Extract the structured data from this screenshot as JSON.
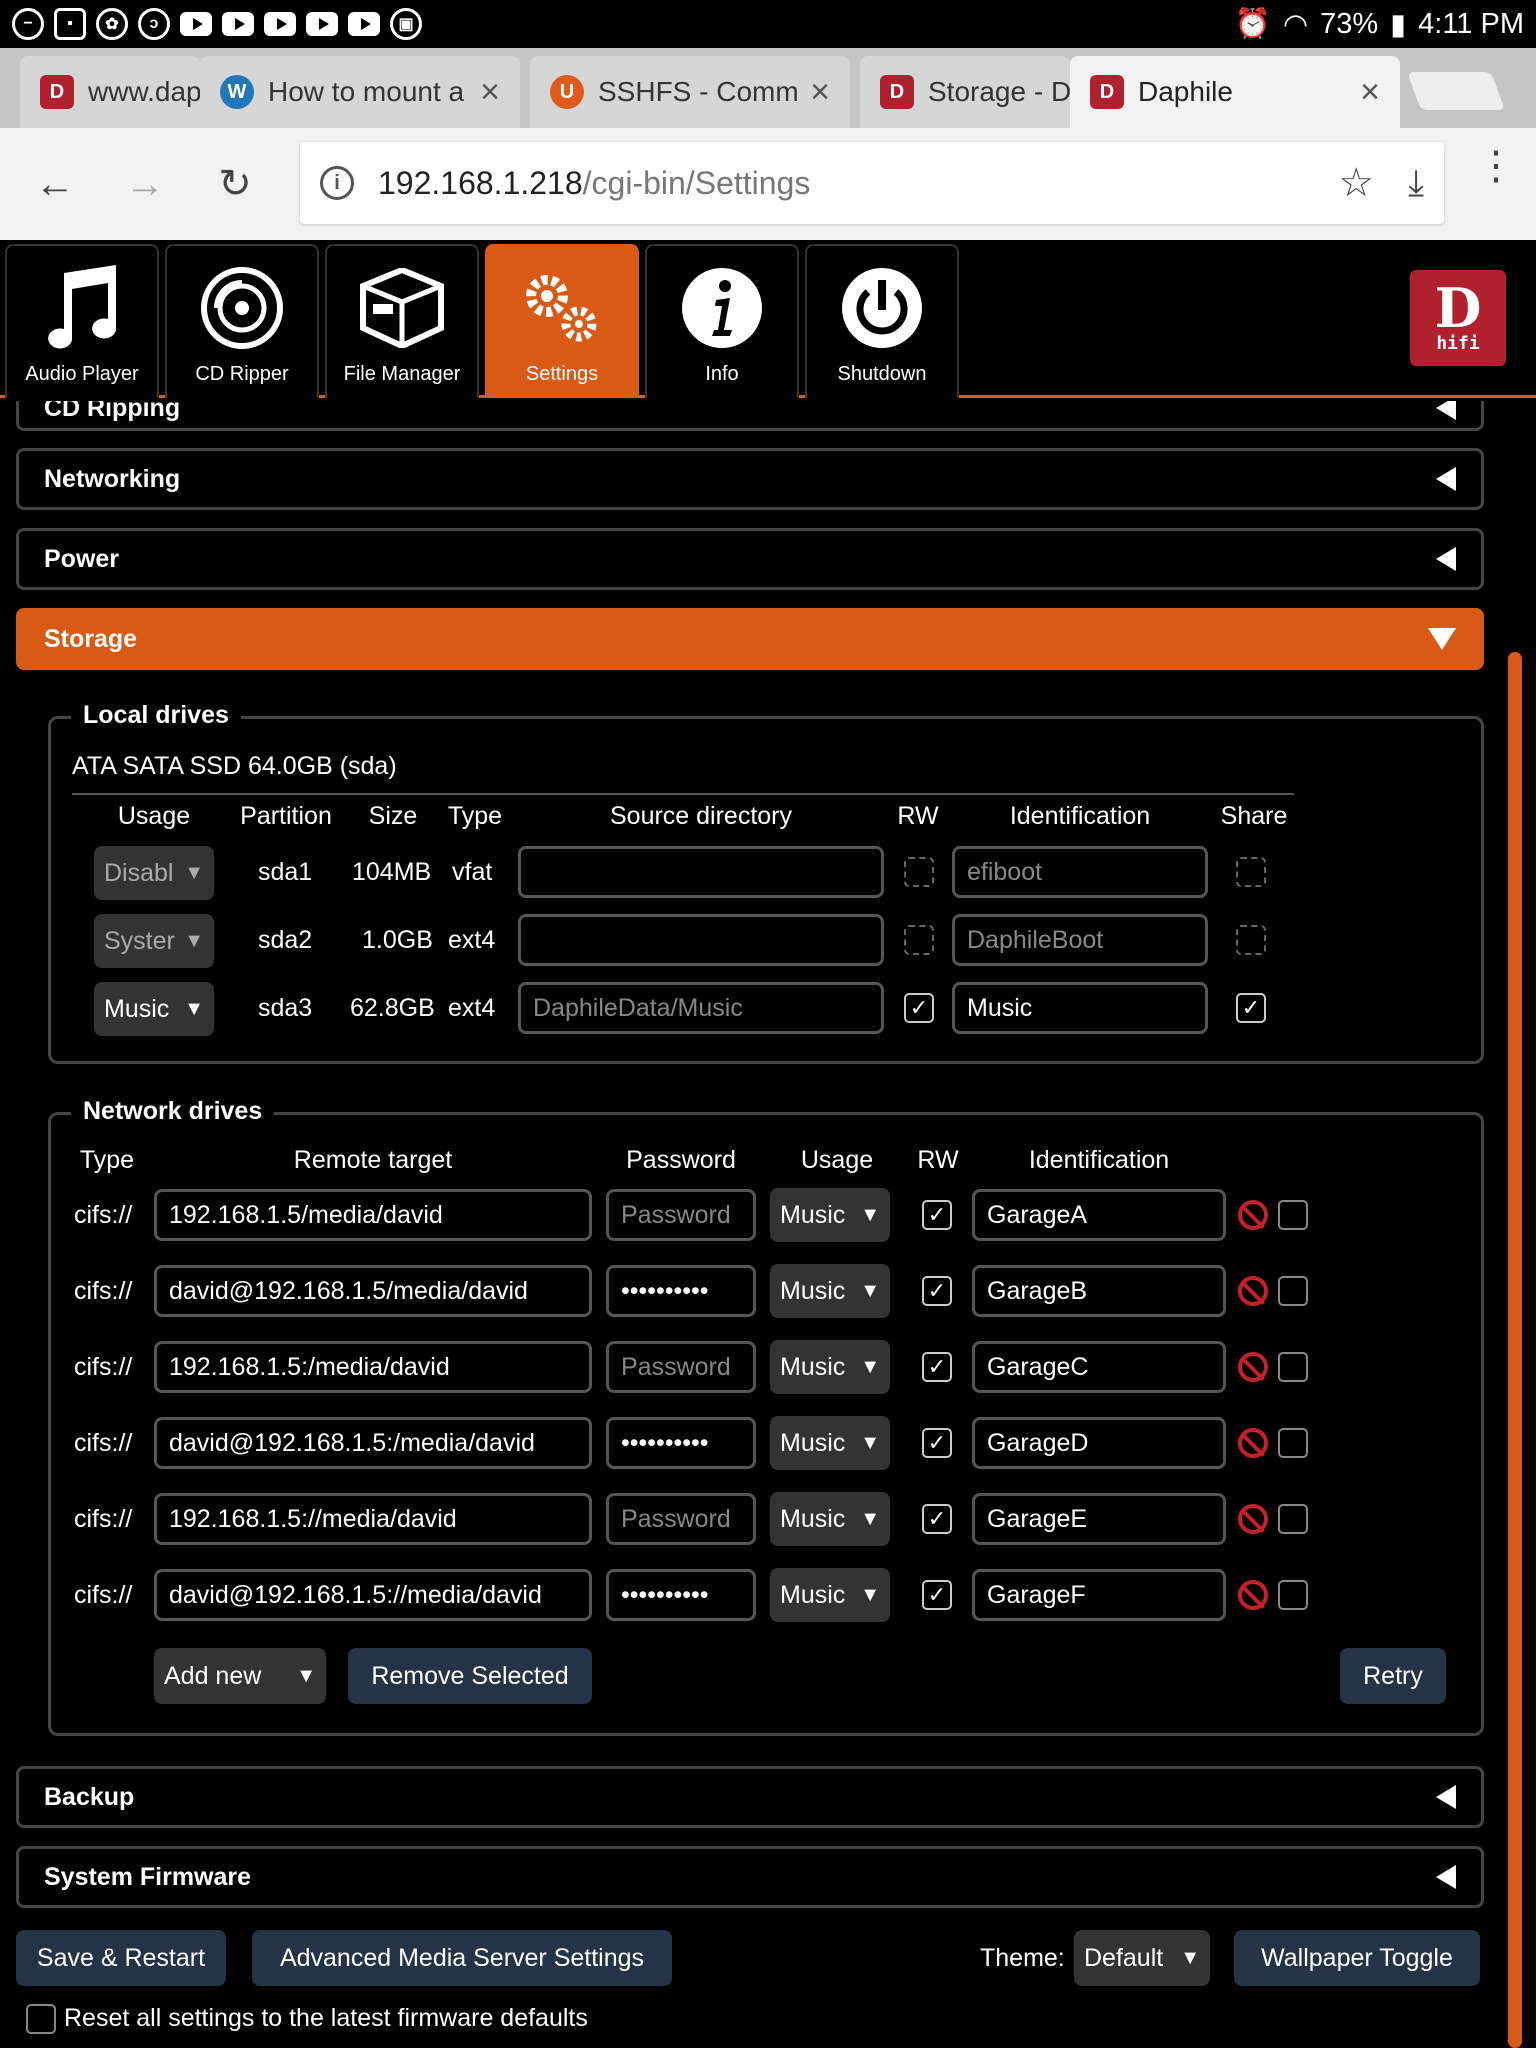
{
  "status_bar": {
    "battery": "73%",
    "time": "4:11 PM"
  },
  "browser": {
    "tabs": [
      {
        "label": "www.daphile",
        "fav": "D"
      },
      {
        "label": "How to mount a",
        "fav": "W"
      },
      {
        "label": "SSHFS - Commu",
        "fav": "U"
      },
      {
        "label": "Storage - D",
        "fav": "D"
      },
      {
        "label": "Daphile",
        "fav": "D"
      }
    ],
    "url_host": "192.168.1.218",
    "url_path": "/cgi-bin/Settings"
  },
  "app_nav": [
    {
      "label": "Audio Player",
      "icon": "music-note-icon"
    },
    {
      "label": "CD Ripper",
      "icon": "disc-icon"
    },
    {
      "label": "File Manager",
      "icon": "box-icon"
    },
    {
      "label": "Settings",
      "icon": "gears-icon"
    },
    {
      "label": "Info",
      "icon": "info-icon"
    },
    {
      "label": "Shutdown",
      "icon": "power-icon"
    }
  ],
  "logo": {
    "d": "D",
    "hifi": "hifi"
  },
  "sections": {
    "cd_ripping": "CD Ripping",
    "networking": "Networking",
    "power": "Power",
    "storage": "Storage",
    "backup": "Backup",
    "firmware": "System Firmware"
  },
  "local_drives": {
    "legend": "Local drives",
    "device": "ATA SATA SSD 64.0GB (sda)",
    "headers": {
      "usage": "Usage",
      "partition": "Partition",
      "size": "Size",
      "type": "Type",
      "source": "Source directory",
      "rw": "RW",
      "ident": "Identification",
      "share": "Share"
    },
    "rows": [
      {
        "usage": "Disabl",
        "partition": "sda1",
        "size": "104MB",
        "type": "vfat",
        "source": "",
        "rw": "",
        "ident": "efiboot",
        "share": ""
      },
      {
        "usage": "Syster",
        "partition": "sda2",
        "size": "1.0GB",
        "type": "ext4",
        "source": "",
        "rw": "",
        "ident": "DaphileBoot",
        "share": ""
      },
      {
        "usage": "Music",
        "partition": "sda3",
        "size": "62.8GB",
        "type": "ext4",
        "source": "DaphileData/Music",
        "rw": "✓",
        "ident": "Music",
        "share": "✓"
      }
    ]
  },
  "network_drives": {
    "legend": "Network drives",
    "headers": {
      "type": "Type",
      "target": "Remote target",
      "password": "Password",
      "usage": "Usage",
      "rw": "RW",
      "ident": "Identification"
    },
    "password_placeholder": "Password",
    "rows": [
      {
        "type": "cifs://",
        "target": "192.168.1.5/media/david",
        "password": "",
        "usage": "Music",
        "rw": "✓",
        "ident": "GarageA"
      },
      {
        "type": "cifs://",
        "target": "david@192.168.1.5/media/david",
        "password": "••••••••••",
        "usage": "Music",
        "rw": "✓",
        "ident": "GarageB"
      },
      {
        "type": "cifs://",
        "target": "192.168.1.5:/media/david",
        "password": "",
        "usage": "Music",
        "rw": "✓",
        "ident": "GarageC"
      },
      {
        "type": "cifs://",
        "target": "david@192.168.1.5:/media/david",
        "password": "••••••••••",
        "usage": "Music",
        "rw": "✓",
        "ident": "GarageD"
      },
      {
        "type": "cifs://",
        "target": "192.168.1.5://media/david",
        "password": "",
        "usage": "Music",
        "rw": "✓",
        "ident": "GarageE"
      },
      {
        "type": "cifs://",
        "target": "david@192.168.1.5://media/david",
        "password": "••••••••••",
        "usage": "Music",
        "rw": "✓",
        "ident": "GarageF"
      }
    ],
    "add_new": "Add new",
    "remove_selected": "Remove Selected",
    "retry": "Retry"
  },
  "footer": {
    "save_restart": "Save & Restart",
    "advanced": "Advanced Media Server Settings",
    "theme_label": "Theme:",
    "theme_value": "Default",
    "wallpaper": "Wallpaper Toggle",
    "reset_label": "Reset all settings to the latest firmware defaults"
  },
  "colors": {
    "accent": "#d95a14",
    "button": "#243345"
  }
}
